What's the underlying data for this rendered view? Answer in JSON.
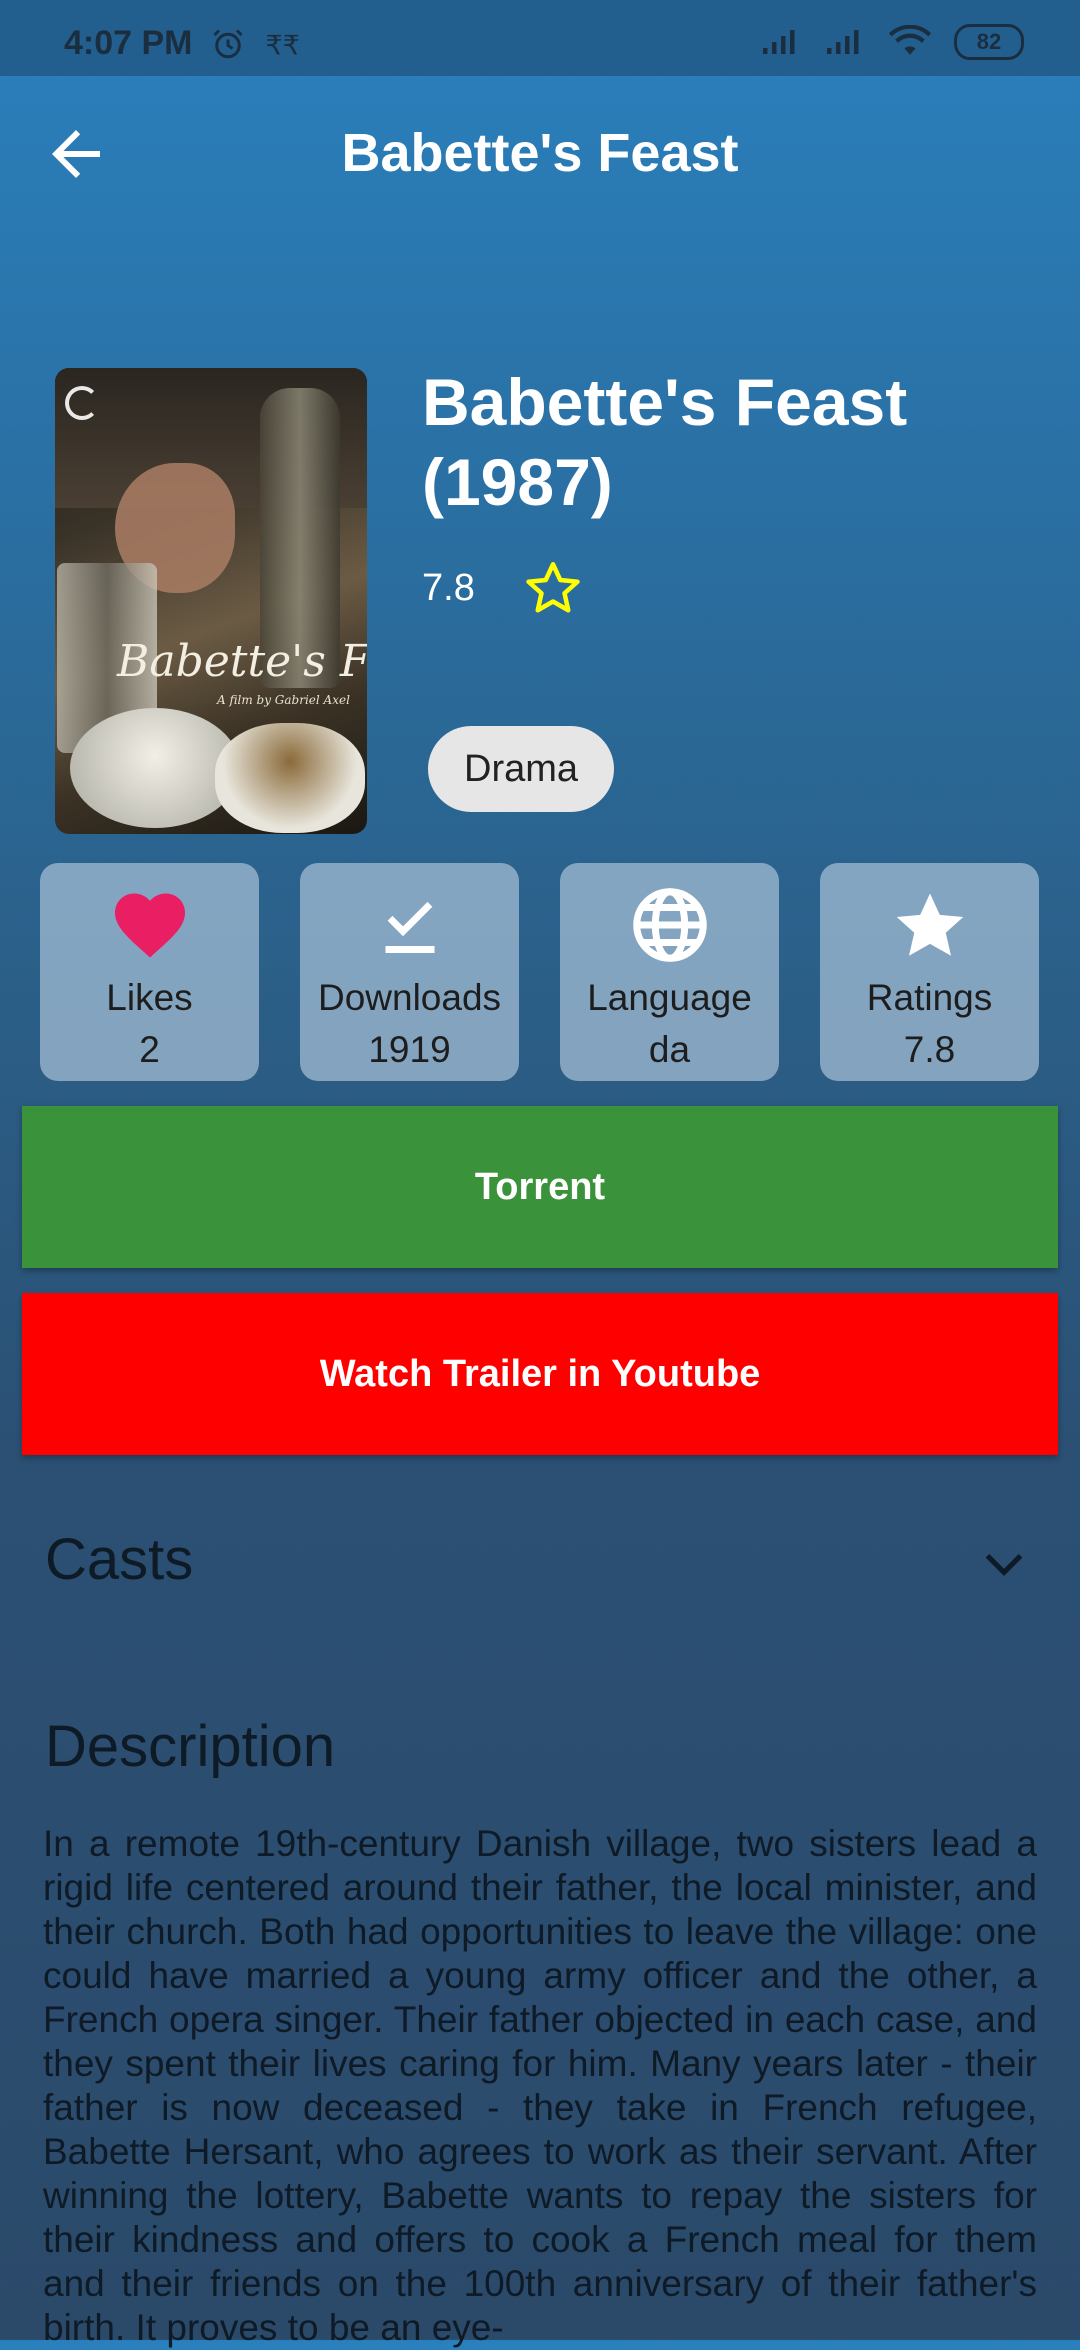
{
  "status_bar": {
    "time": "4:07 PM",
    "extra_icons": [
      "alarm-icon",
      "rupee-icon"
    ],
    "battery": "82"
  },
  "app_bar": {
    "title": "Babette's Feast"
  },
  "movie": {
    "title": "Babette's Feast (1987)",
    "rating": "7.8",
    "genre": "Drama",
    "poster": {
      "title": "Babette's Feast",
      "subtitle": "A film by Gabriel Axel"
    }
  },
  "stats": [
    {
      "label": "Likes",
      "value": "2",
      "icon": "heart-icon",
      "icon_color": "#e91e63"
    },
    {
      "label": "Downloads",
      "value": "1919",
      "icon": "download-done-icon",
      "icon_color": "#ffffff"
    },
    {
      "label": "Language",
      "value": "da",
      "icon": "globe-icon",
      "icon_color": "#ffffff"
    },
    {
      "label": "Ratings",
      "value": "7.8",
      "icon": "star-icon",
      "icon_color": "#ffffff"
    }
  ],
  "buttons": {
    "torrent": "Torrent",
    "trailer": "Watch Trailer in Youtube"
  },
  "sections": {
    "casts": "Casts",
    "description": "Description",
    "description_text": "In a remote 19th-century Danish village, two sisters lead a rigid life centered around their father, the local minister, and their church. Both had opportunities to leave the village: one could have married a young army officer and the other, a French opera singer. Their father objected in each case, and they spent their lives caring for him. Many years later - their father is now deceased - they take in French refugee, Babette Hersant, who agrees to work as their servant. After winning the lottery, Babette wants to repay the sisters for their kindness and offers to cook a French meal for them and their friends on the 100th anniversary of their father's birth. It proves to be an eye-"
  },
  "colors": {
    "torrent": "#3a923b",
    "trailer": "#fe0000",
    "rating_star": "#ffff00",
    "chip": "#e6e6e6"
  }
}
